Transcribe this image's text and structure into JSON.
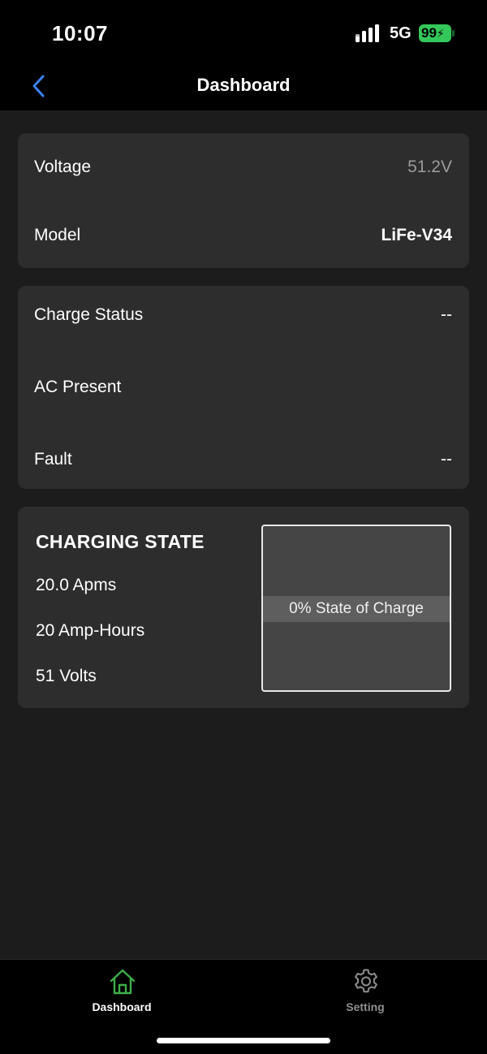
{
  "status_bar": {
    "time": "10:07",
    "network": "5G",
    "battery": "99",
    "battery_color": "#34c759"
  },
  "nav": {
    "title": "Dashboard",
    "back_icon": "chevron-left-icon",
    "accent_color": "#3b82f6"
  },
  "battery_info": {
    "voltage_label": "Voltage",
    "voltage_value": "51.2V",
    "model_label": "Model",
    "model_value": "LiFe-V34"
  },
  "charge_info": {
    "charge_status_label": "Charge Status",
    "charge_status_value": "--",
    "ac_present_label": "AC Present",
    "ac_present_value": "",
    "fault_label": "Fault",
    "fault_value": "--"
  },
  "charging_state": {
    "title": "CHARGING STATE",
    "amps": "20.0 Apms",
    "amp_hours": "20 Amp-Hours",
    "volts": "51 Volts",
    "state_of_charge_label": "0% State of Charge",
    "state_of_charge_percent": 0
  },
  "tab_bar": {
    "tabs": [
      {
        "label": "Dashboard",
        "icon": "home-icon",
        "active": true,
        "color": "#3fae49"
      },
      {
        "label": "Setting",
        "icon": "gear-icon",
        "active": false,
        "color": "#8e8e8e"
      }
    ]
  }
}
